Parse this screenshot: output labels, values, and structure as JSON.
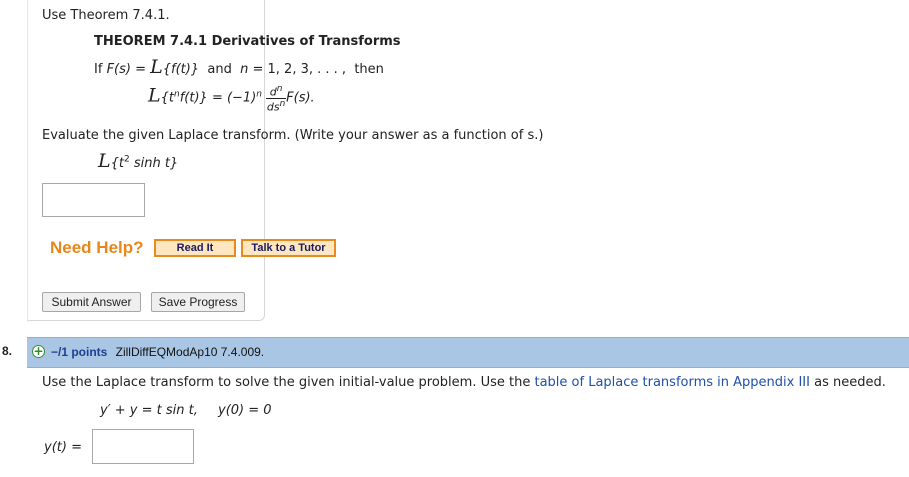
{
  "q7": {
    "instruction": "Use Theorem 7.4.1.",
    "theorem_title": "THEOREM 7.4.1  Derivatives of Transforms",
    "theorem_if": "If",
    "theorem_fs": "F(s) =",
    "script_L": "L",
    "theorem_ft": "{f(t)}",
    "theorem_and": "and",
    "theorem_n": "n",
    "theorem_nvals": "= 1, 2, 3, . . . ,",
    "theorem_then": "then",
    "formula_left": "{t",
    "formula_n_sup": "n",
    "formula_ft": "f(t)} = (−1)",
    "formula_n_sup2": "n",
    "frac_num": "d",
    "frac_num_sup": "n",
    "frac_den": "ds",
    "frac_den_sup": "n",
    "formula_Fs": "F(s).",
    "evaluate_text": "Evaluate the given Laplace transform. (Write your answer as a function of s.)",
    "transform_open": "{t",
    "transform_sup": "2",
    "transform_rest": " sinh t}",
    "answer_value": "",
    "need_help": "Need Help?",
    "read_it": "Read It",
    "talk_tutor": "Talk to a Tutor",
    "submit": "Submit Answer",
    "save": "Save Progress"
  },
  "q8": {
    "number": "8.",
    "points": "−/1 points",
    "id": "ZillDiffEQModAp10 7.4.009.",
    "prompt_pre": "Use the Laplace transform to solve the given initial-value problem. Use the ",
    "prompt_link": "table of Laplace transforms in Appendix III",
    "prompt_post": " as needed.",
    "equation": "y′ + y = t sin t,",
    "initial": "y(0) = 0",
    "y_label": "y(t) =",
    "answer_value": ""
  },
  "colors": {
    "header_bg": "#a9c6e4",
    "help_orange": "#e8861c",
    "link_blue": "#1f4fa8",
    "points_blue": "#1f3f8f"
  }
}
